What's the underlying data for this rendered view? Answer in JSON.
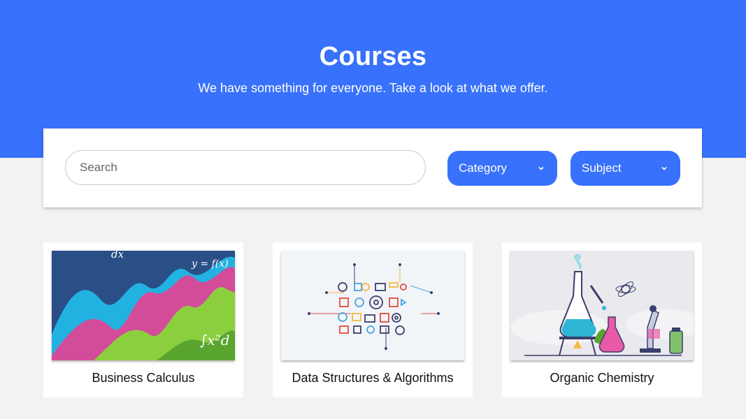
{
  "hero": {
    "title": "Courses",
    "subtitle": "We have something for everyone. Take a look at what we offer."
  },
  "filters": {
    "search_placeholder": "Search",
    "category_label": "Category",
    "subject_label": "Subject"
  },
  "courses": [
    {
      "title": "Business Calculus",
      "image": "calculus-graph-illustration"
    },
    {
      "title": "Data Structures & Algorithms",
      "image": "data-network-icons-illustration"
    },
    {
      "title": "Organic Chemistry",
      "image": "chemistry-lab-illustration"
    }
  ],
  "colors": {
    "brand_blue": "#3871fb",
    "page_background": "#f2f2f2"
  }
}
